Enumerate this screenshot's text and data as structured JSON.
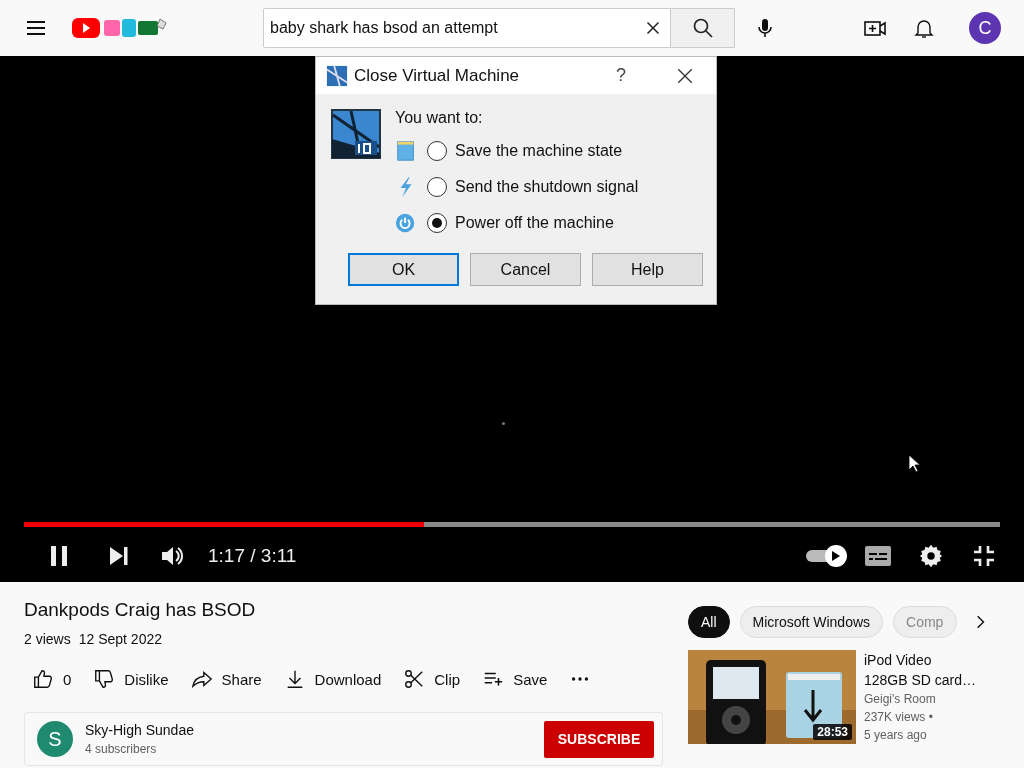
{
  "header": {
    "search": {
      "value": "baby shark has bsod an attempt"
    },
    "avatar_letter": "C"
  },
  "player": {
    "dialog": {
      "title": "Close Virtual Machine",
      "help": "?",
      "prompt": "You want to:",
      "options": [
        {
          "kind": "save",
          "label": "Save the machine state",
          "selected": false
        },
        {
          "kind": "shutdown",
          "label": "Send the shutdown signal",
          "selected": false
        },
        {
          "kind": "poweroff",
          "label": "Power off the machine",
          "selected": true
        }
      ],
      "buttons": [
        {
          "label": "OK",
          "default": true
        },
        {
          "label": "Cancel",
          "default": false
        },
        {
          "label": "Help",
          "default": false
        }
      ]
    },
    "progress": {
      "level": 0.41
    },
    "time": "1:17 / 3:11",
    "autoplay": {
      "on": true
    }
  },
  "video": {
    "title": "Dankpods Craig has BSOD",
    "views": "2 views",
    "date": "12 Sept 2022",
    "actions": [
      {
        "kind": "like",
        "label": "0"
      },
      {
        "kind": "dislike",
        "label": "Dislike"
      },
      {
        "kind": "share",
        "label": "Share"
      },
      {
        "kind": "download",
        "label": "Download"
      },
      {
        "kind": "clip",
        "label": "Clip"
      },
      {
        "kind": "save",
        "label": "Save"
      },
      {
        "kind": "more"
      }
    ],
    "channel": {
      "avatar_letter": "S",
      "name": "Sky-High Sundae",
      "subscribers": "4 subscribers",
      "subscribe": "SUBSCRIBE"
    }
  },
  "chips": [
    {
      "label": "All",
      "selected": true
    },
    {
      "label": "Microsoft Windows",
      "selected": false
    },
    {
      "label": "Comp",
      "selected": false
    }
  ],
  "recommendations": [
    {
      "title_lines": [
        "iPod Video",
        "128GB SD card…"
      ],
      "duration": "28:53",
      "channel": "Geigi's Room",
      "views": "237K views •",
      "age": "5 years ago"
    }
  ]
}
